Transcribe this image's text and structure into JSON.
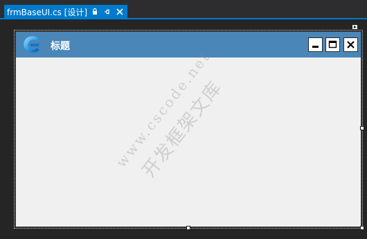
{
  "document_tab": {
    "title": "frmBaseUI.cs [设计]",
    "pin_icon": "pin-icon",
    "lock_icon": "lock-icon",
    "close_icon": "close-icon"
  },
  "form": {
    "title": "标题",
    "logo_icon": "app-logo-icon",
    "minimize_icon": "minimize-icon",
    "maximize_icon": "maximize-icon",
    "close_icon": "close-icon"
  },
  "watermark": {
    "line1": "www.cscode.net",
    "line2": "开发框架文库"
  },
  "colors": {
    "tab_accent": "#007acc",
    "titlebar": "#4a86b8",
    "form_background": "#f0f0f0",
    "ide_background": "#2d2d30"
  }
}
